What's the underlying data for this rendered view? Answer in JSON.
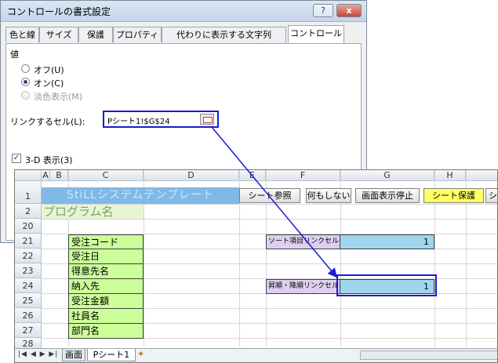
{
  "dialog": {
    "title": "コントロールの書式設定",
    "help_button": "?",
    "close_button": "x",
    "tabs": [
      "色と線",
      "サイズ",
      "保護",
      "プロパティ",
      "代わりに表示する文字列",
      "コントロール"
    ],
    "active_tab": "コントロール",
    "value_group_label": "値",
    "radio_off": "オフ(U)",
    "radio_on": "オン(C)",
    "radio_mixed": "淡色表示(M)",
    "selected_radio": "オン(C)",
    "link_cell_label": "リンクするセル(L):",
    "link_cell_value": "Pシート1!$G$24",
    "checkbox_3d": "3-D 表示(3)",
    "checkbox_3d_checked": true
  },
  "sheet": {
    "columns": [
      "A",
      "B",
      "C",
      "D",
      "E",
      "F",
      "G",
      "H"
    ],
    "rows": [
      "1",
      "2",
      "20",
      "21",
      "22",
      "23",
      "24",
      "25",
      "26",
      "27",
      "28"
    ],
    "banner": "StiLLシステムテンプレート",
    "program_name": "プログラム名",
    "buttons": [
      "シート参照",
      "何もしない",
      "画面表示停止",
      "シート保護",
      "シ"
    ],
    "fields": [
      "受注コード",
      "受注日",
      "得意先名",
      "納入先",
      "受注金額",
      "社員名",
      "部門名"
    ],
    "sort_item_label": "ソート項目リンクセル",
    "sort_item_value": "1",
    "asc_desc_label": "昇順・降順リンクセル",
    "asc_desc_value": "1",
    "sheet_tabs": [
      "画面",
      "Pシート1"
    ],
    "active_sheet": "Pシート1"
  },
  "colors": {
    "highlight_border": "#1b1bd6",
    "field_fill": "#ccff99",
    "label_fill": "#ddd0ee",
    "value_fill": "#9fd6ee",
    "banner_fill": "#7fb9e6",
    "protect_button_fill": "#ffff66"
  }
}
